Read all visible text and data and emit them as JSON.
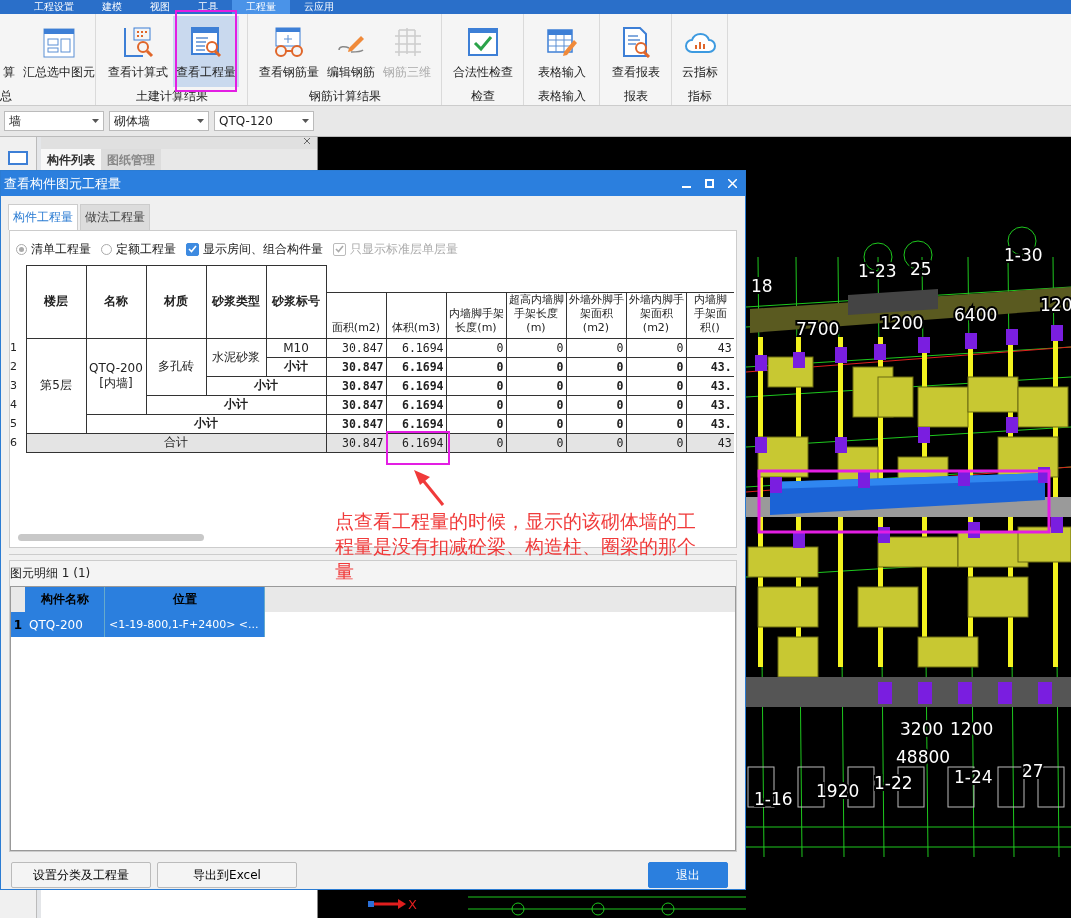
{
  "menu": [
    {
      "label": "工程设置",
      "selected": false
    },
    {
      "label": "建模",
      "selected": false
    },
    {
      "label": "视图",
      "selected": false
    },
    {
      "label": "工具",
      "selected": false
    },
    {
      "label": "工程量",
      "selected": true
    },
    {
      "label": "云应用",
      "selected": false
    }
  ],
  "ribbon": [
    {
      "label": "总",
      "buttons": [
        {
          "label": "算",
          "selected": false,
          "disabled": false
        },
        {
          "label": "汇总选中图元",
          "kind": "sum",
          "selected": false,
          "disabled": false
        }
      ]
    },
    {
      "label": "土建计算结果",
      "buttons": [
        {
          "label": "查看计算式",
          "kind": "formula",
          "selected": false,
          "disabled": false
        },
        {
          "label": "查看工程量",
          "kind": "quantity",
          "selected": true,
          "disabled": false
        }
      ]
    },
    {
      "label": "钢筋计算结果",
      "buttons": [
        {
          "label": "查看钢筋量",
          "kind": "rebar",
          "selected": false,
          "disabled": false
        },
        {
          "label": "编辑钢筋",
          "kind": "edit",
          "selected": false,
          "disabled": false
        },
        {
          "label": "钢筋三维",
          "kind": "rebar3d",
          "selected": false,
          "disabled": true
        }
      ]
    },
    {
      "label": "检查",
      "buttons": [
        {
          "label": "合法性检查",
          "kind": "check",
          "selected": false,
          "disabled": false
        }
      ]
    },
    {
      "label": "表格输入",
      "buttons": [
        {
          "label": "表格输入",
          "kind": "table",
          "selected": false,
          "disabled": false
        }
      ]
    },
    {
      "label": "报表",
      "buttons": [
        {
          "label": "查看报表",
          "kind": "report",
          "selected": false,
          "disabled": false
        }
      ]
    },
    {
      "label": "指标",
      "buttons": [
        {
          "label": "云指标",
          "kind": "cloud",
          "selected": false,
          "disabled": false
        }
      ]
    }
  ],
  "selectors": [
    {
      "value": "墙"
    },
    {
      "value": "砌体墙"
    },
    {
      "value": "QTQ-120"
    }
  ],
  "side_panel": {
    "tabs": [
      {
        "label": "构件列表",
        "selected": true
      },
      {
        "label": "图纸管理",
        "selected": false
      }
    ]
  },
  "dialog": {
    "title": "查看构件图元工程量",
    "tabs": [
      {
        "label": "构件工程量",
        "selected": true
      },
      {
        "label": "做法工程量",
        "selected": false
      }
    ],
    "options": [
      {
        "kind": "radio",
        "label": "清单工程量",
        "checked": true,
        "disabled": false
      },
      {
        "kind": "radio",
        "label": "定额工程量",
        "checked": false,
        "disabled": false
      },
      {
        "kind": "checkbox",
        "label": "显示房间、组合构件量",
        "checked": true,
        "disabled": false
      },
      {
        "kind": "checkbox",
        "label": "只显示标准层单层量",
        "checked": true,
        "disabled": true
      }
    ],
    "table": {
      "columns": [
        "楼层",
        "名称",
        "材质",
        "砂浆类型",
        "砂浆标号",
        "面积(m2)",
        "体积(m3)",
        "内墙脚手架长度(m)",
        "超高内墙脚手架长度(m)",
        "外墙外脚手架面积(m2)",
        "外墙内脚手架面积(m2)",
        "内墙脚手架面积()"
      ],
      "rows": [
        {
          "label": "第5层",
          "children": [
            {
              "label": "QTQ-200 [内墙]",
              "children": [
                {
                  "label": "多孔砖",
                  "children": [
                    {
                      "label": "水泥砂浆",
                      "children": [
                        {
                          "no": "1",
                          "label": "M10",
                          "values": [
                            "30.847",
                            "6.1694",
                            "0",
                            "0",
                            "0",
                            "0",
                            "43"
                          ]
                        }
                      ],
                      "subtotal": {
                        "no": "2",
                        "label": "小计",
                        "values": [
                          "30.847",
                          "6.1694",
                          "0",
                          "0",
                          "0",
                          "0",
                          "43."
                        ]
                      }
                    }
                  ],
                  "subtotal": {
                    "no": "3",
                    "label": "小计",
                    "values": [
                      "30.847",
                      "6.1694",
                      "0",
                      "0",
                      "0",
                      "0",
                      "43."
                    ]
                  }
                }
              ],
              "subtotal": {
                "no": "4",
                "label": "小计",
                "values": [
                  "30.847",
                  "6.1694",
                  "0",
                  "0",
                  "0",
                  "0",
                  "43."
                ]
              }
            }
          ],
          "subtotal": {
            "no": "5",
            "label": "小计",
            "values": [
              "30.847",
              "6.1694",
              "0",
              "0",
              "0",
              "0",
              "43."
            ]
          }
        }
      ],
      "total": {
        "no": "6",
        "label": "合计",
        "values": [
          "30.847",
          "6.1694",
          "0",
          "0",
          "0",
          "0",
          "43"
        ]
      }
    },
    "detail": {
      "label": "图元明细  1 (1)",
      "columns": [
        "构件名称",
        "位置"
      ],
      "rows": [
        {
          "no": "1",
          "cells": [
            "QTQ-200",
            "<1-19-800,1-F+2400> <..."
          ],
          "selected": true
        }
      ]
    },
    "buttons": [
      {
        "label": "设置分类及工程量",
        "kind": "normal"
      },
      {
        "label": "导出到Excel",
        "kind": "normal"
      },
      {
        "label": "退出",
        "kind": "primary"
      }
    ],
    "note": "点查看工程量的时候，显示的该砌体墙的工程量是没有扣减砼梁、构造柱、圈梁的那个量"
  },
  "cad": {
    "labels": [
      "18",
      "7700",
      "1-23",
      "25",
      "1200",
      "6400",
      "1-30",
      "120",
      "3200",
      "1200",
      "48800",
      "1-22",
      "1-24",
      "27",
      "1-16",
      "1920"
    ],
    "axis": "X"
  }
}
